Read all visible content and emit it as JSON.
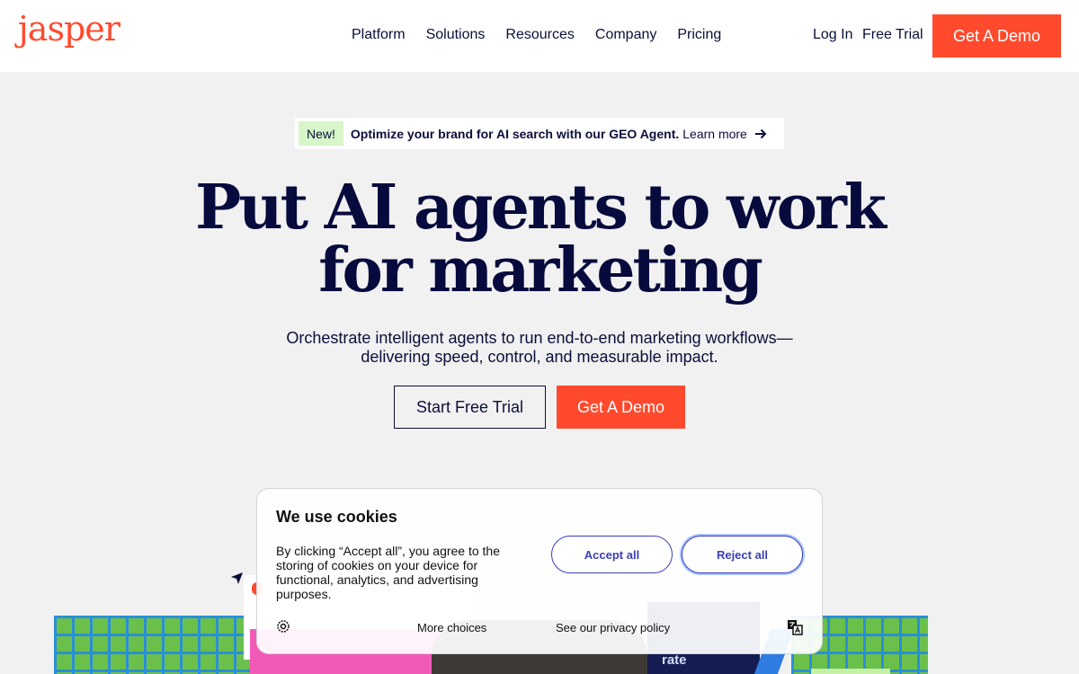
{
  "header": {
    "logo": "jasper",
    "nav": [
      "Platform",
      "Solutions",
      "Resources",
      "Company",
      "Pricing"
    ],
    "login": "Log In",
    "free_trial": "Free Trial",
    "demo": "Get A Demo"
  },
  "announcement": {
    "badge": "New!",
    "text": "Optimize your brand for AI search with our GEO Agent.",
    "link": "Learn more",
    "icon": "arrow-right-icon"
  },
  "hero": {
    "title_line1": "Put AI agents to work",
    "title_line2": "for marketing",
    "subtitle_line1": "Orchestrate intelligent agents to run end-to-end marketing workflows—",
    "subtitle_line2": "delivering speed, control, and measurable impact.",
    "cta_trial": "Start Free Trial",
    "cta_demo": "Get A Demo"
  },
  "illustration": {
    "rate_label": "rate"
  },
  "cookie": {
    "title": "We use cookies",
    "body": "By clicking “Accept all”, you agree to the storing of cookies on your device for functional, analytics, and advertising purposes.",
    "accept": "Accept all",
    "reject": "Reject all",
    "more_choices": "More choices",
    "privacy": "See our privacy policy"
  },
  "colors": {
    "brand": "#ff4a2e",
    "navy": "#070a3c",
    "cookie_accent": "#3b3fb8",
    "grid_green": "#6ac04a",
    "grid_blue": "#2a8fd8"
  }
}
